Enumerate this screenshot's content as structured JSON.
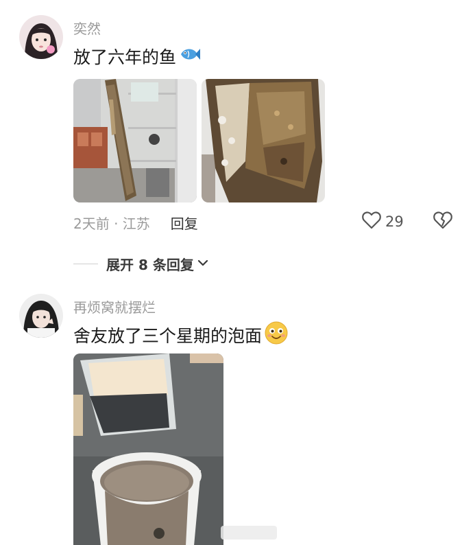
{
  "comments": [
    {
      "username": "奕然",
      "text": "放了六年的鱼",
      "emoji": "fish-emoji",
      "time_location": "2天前 · 江苏",
      "reply_label": "回复",
      "like_count": "29"
    },
    {
      "username": "再烦窝就摆烂",
      "text": "舍友放了三个星期的泡面",
      "emoji": "smile-emoji"
    }
  ],
  "expand": {
    "label": "展开 8 条回复"
  },
  "colors": {
    "muted_text": "#9a9a9a",
    "primary_text": "#1a1a1a",
    "fish_emoji": "#4a9fe0",
    "smile_emoji": "#f7c948"
  }
}
